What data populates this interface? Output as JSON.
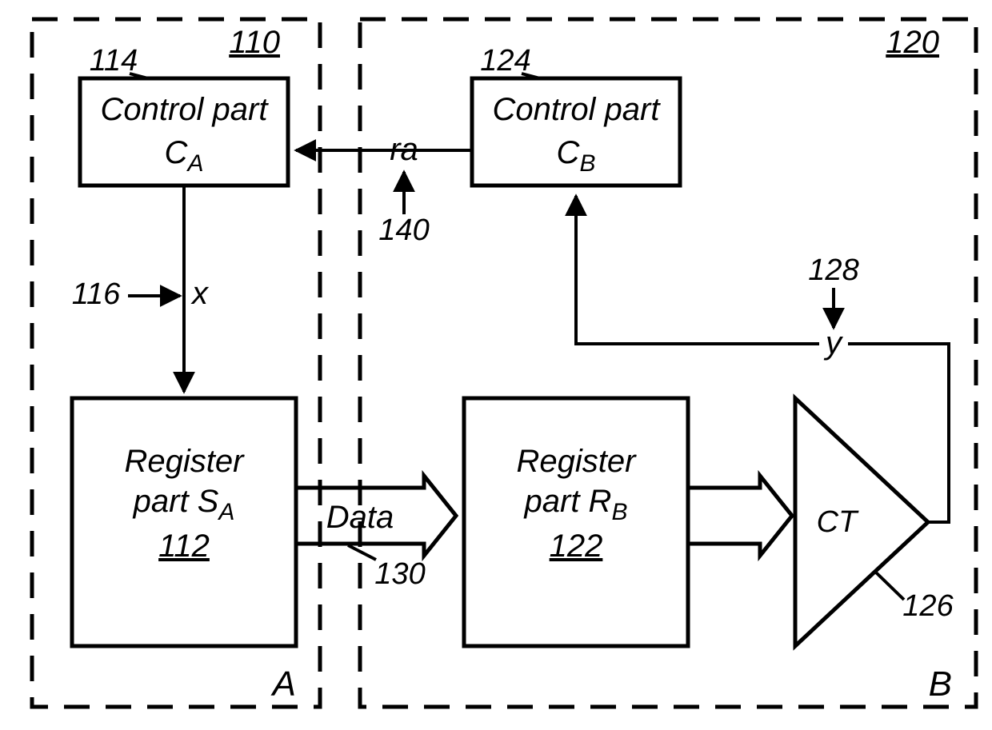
{
  "regionA": {
    "ref": "110",
    "label": "A",
    "control": {
      "ref": "114",
      "line1": "Control part",
      "sub": "A",
      "symbolPrefix": "C"
    },
    "register": {
      "ref": "112",
      "line1": "Register",
      "line2prefix": "part S",
      "sub": "A"
    },
    "signal_x": {
      "ref": "116",
      "name": "x"
    }
  },
  "regionB": {
    "ref": "120",
    "label": "B",
    "control": {
      "ref": "124",
      "line1": "Control part",
      "sub": "B",
      "symbolPrefix": "C"
    },
    "register": {
      "ref": "122",
      "line1": "Register",
      "line2prefix": "part R",
      "sub": "B"
    },
    "ct": {
      "ref": "126",
      "label": "CT"
    },
    "signal_y": {
      "ref": "128",
      "name": "y"
    }
  },
  "signals": {
    "ra": {
      "ref": "140",
      "name": "ra"
    },
    "data": {
      "ref": "130",
      "name": "Data"
    }
  }
}
